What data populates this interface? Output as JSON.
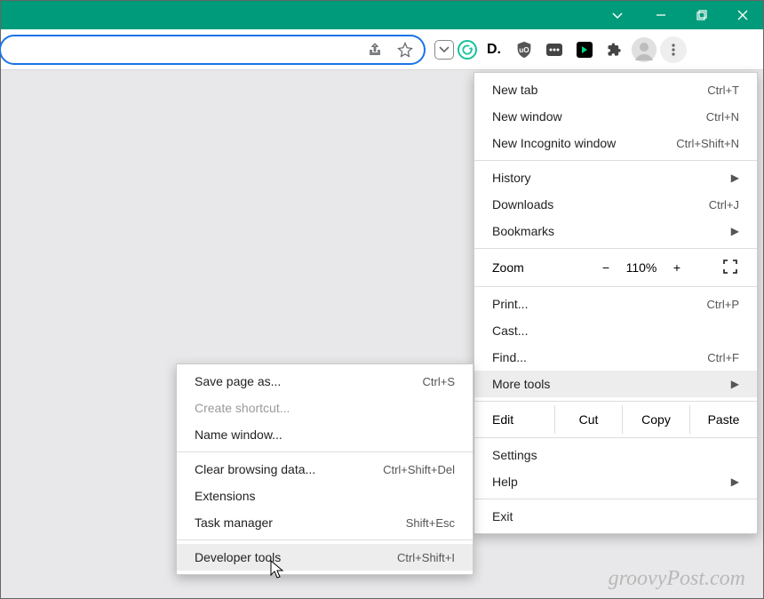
{
  "titlebar": {
    "chevron": "⌄",
    "minimize": "—",
    "maximize": "❐",
    "close": "✕"
  },
  "omnibox": {
    "share_icon": "share-icon",
    "star_icon": "star-icon"
  },
  "extensions": {
    "pocket": "⌄",
    "grammarly": "G",
    "d": "D.",
    "ublock": "🛡",
    "social": "▦",
    "pp": "▶",
    "puzzle": "🧩"
  },
  "menu": {
    "new_tab": "New tab",
    "new_tab_sc": "Ctrl+T",
    "new_window": "New window",
    "new_window_sc": "Ctrl+N",
    "new_incognito": "New Incognito window",
    "new_incognito_sc": "Ctrl+Shift+N",
    "history": "History",
    "downloads": "Downloads",
    "downloads_sc": "Ctrl+J",
    "bookmarks": "Bookmarks",
    "zoom_label": "Zoom",
    "zoom_minus": "−",
    "zoom_value": "110%",
    "zoom_plus": "+",
    "fullscreen": "⛶",
    "print": "Print...",
    "print_sc": "Ctrl+P",
    "cast": "Cast...",
    "find": "Find...",
    "find_sc": "Ctrl+F",
    "more_tools": "More tools",
    "edit_label": "Edit",
    "cut": "Cut",
    "copy": "Copy",
    "paste": "Paste",
    "settings": "Settings",
    "help": "Help",
    "exit": "Exit"
  },
  "submenu": {
    "save_page": "Save page as...",
    "save_page_sc": "Ctrl+S",
    "create_shortcut": "Create shortcut...",
    "name_window": "Name window...",
    "clear_data": "Clear browsing data...",
    "clear_data_sc": "Ctrl+Shift+Del",
    "extensions": "Extensions",
    "task_manager": "Task manager",
    "task_manager_sc": "Shift+Esc",
    "dev_tools": "Developer tools",
    "dev_tools_sc": "Ctrl+Shift+I"
  },
  "watermark": "groovyPost.com"
}
